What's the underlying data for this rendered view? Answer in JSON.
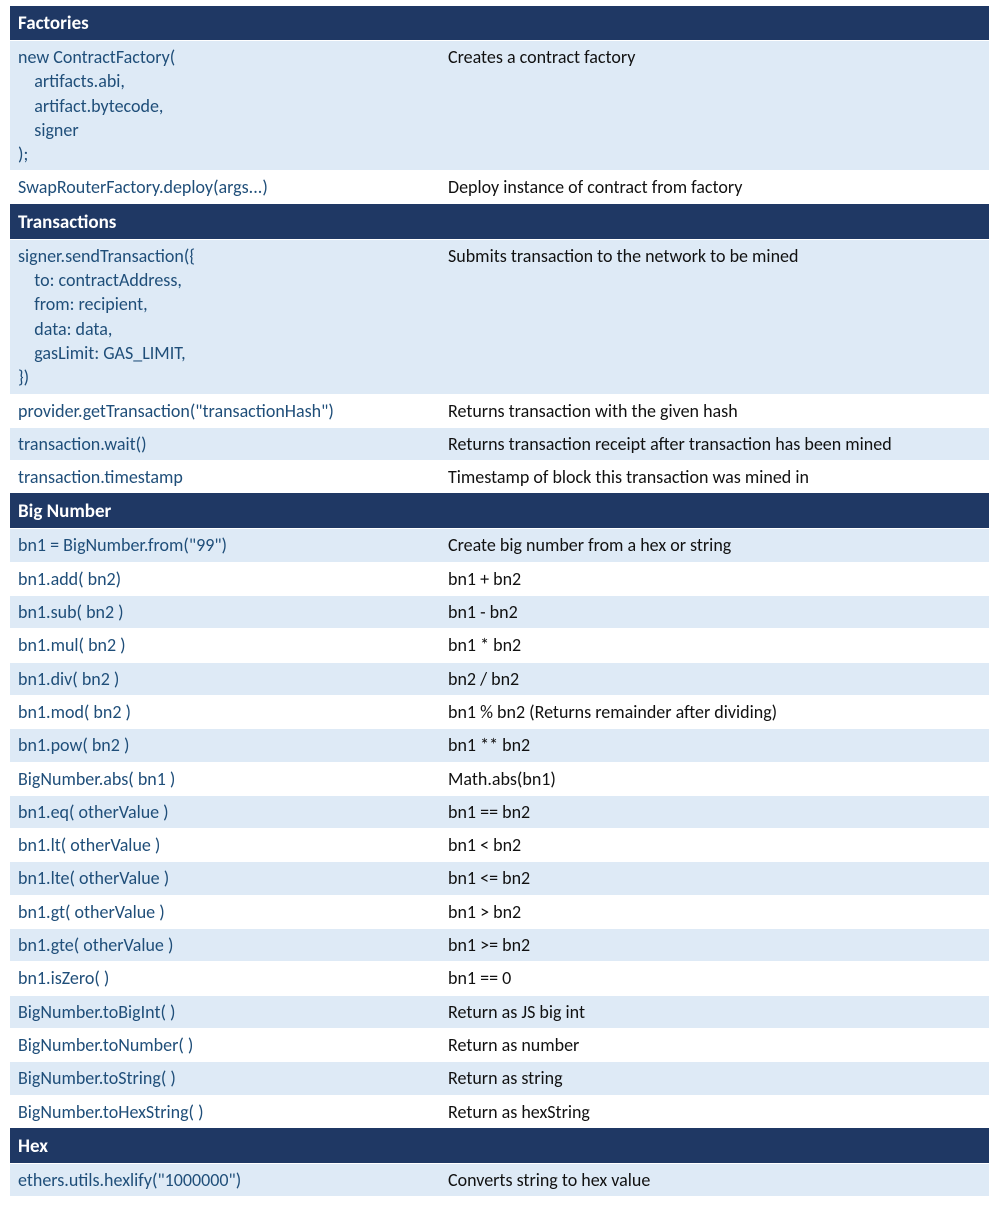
{
  "sections": [
    {
      "title": "Factories",
      "rows": [
        {
          "code": "new ContractFactory(\n    artifacts.abi,\n    artifact.bytecode,\n    signer\n);",
          "desc": "Creates a contract factory"
        },
        {
          "code": "SwapRouterFactory.deploy(args...)",
          "desc": "Deploy instance of contract from factory"
        }
      ]
    },
    {
      "title": "Transactions",
      "rows": [
        {
          "code": "signer.sendTransaction({\n    to: contractAddress,\n    from: recipient,\n    data: data,\n    gasLimit: GAS_LIMIT,\n})",
          "desc": "Submits transaction to the network to be mined"
        },
        {
          "code": "provider.getTransaction(\"transactionHash\")",
          "desc": "Returns transaction with the given hash"
        },
        {
          "code": "transaction.wait()",
          "desc": "Returns transaction receipt after transaction has been mined"
        },
        {
          "code": "transaction.timestamp",
          "desc": "Timestamp of block this transaction was mined in"
        }
      ]
    },
    {
      "title": "Big Number",
      "rows": [
        {
          "code": "bn1 = BigNumber.from(\"99\")",
          "desc": "Create big number from a hex or string"
        },
        {
          "code": "bn1.add( bn2)",
          "desc": "bn1 + bn2"
        },
        {
          "code": "bn1.sub( bn2 )",
          "desc": "bn1 - bn2"
        },
        {
          "code": "bn1.mul( bn2 )",
          "desc": "bn1 * bn2"
        },
        {
          "code": "bn1.div( bn2 )",
          "desc": "bn2 / bn2"
        },
        {
          "code": "bn1.mod( bn2 )",
          "desc": "bn1 % bn2 (Returns remainder after dividing)"
        },
        {
          "code": "bn1.pow( bn2 )",
          "desc": "bn1 ** bn2"
        },
        {
          "code": "BigNumber.abs( bn1 )",
          "desc": "Math.abs(bn1)"
        },
        {
          "code": "bn1.eq( otherValue )",
          "desc": "bn1 == bn2"
        },
        {
          "code": "bn1.lt( otherValue )",
          "desc": "bn1 < bn2"
        },
        {
          "code": "bn1.lte( otherValue )",
          "desc": "bn1 <= bn2"
        },
        {
          "code": "bn1.gt( otherValue )",
          "desc": "bn1 > bn2"
        },
        {
          "code": "bn1.gte( otherValue )",
          "desc": "bn1 >= bn2"
        },
        {
          "code": "bn1.isZero( )",
          "desc": "bn1 == 0"
        },
        {
          "code": "BigNumber.toBigInt( )",
          "desc": "Return as JS big int"
        },
        {
          "code": "BigNumber.toNumber( )",
          "desc": "Return as number"
        },
        {
          "code": "BigNumber.toString( )",
          "desc": "Return as string"
        },
        {
          "code": "BigNumber.toHexString( )",
          "desc": "Return as hexString"
        }
      ]
    },
    {
      "title": "Hex",
      "rows": [
        {
          "code": "ethers.utils.hexlify(\"1000000\")",
          "desc": "Converts string to hex value"
        }
      ]
    }
  ]
}
